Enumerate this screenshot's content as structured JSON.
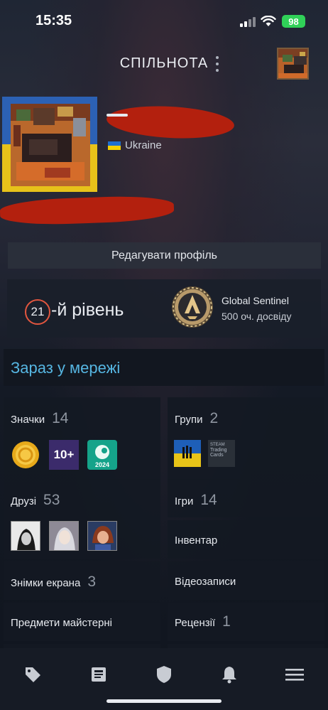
{
  "status_bar": {
    "time": "15:35",
    "battery": "98"
  },
  "header": {
    "title": "СПІЛЬНОТА",
    "menu_icon": "more-vertical-icon"
  },
  "profile": {
    "country": "Ukraine"
  },
  "edit_profile_label": "Редагувати профіль",
  "level": {
    "number": "21",
    "suffix": "-й рівень",
    "badge_name": "Global Sentinel",
    "badge_xp": "500 оч. досвіду"
  },
  "online_status": "Зараз у мережі",
  "tiles": {
    "badges": {
      "label": "Значки",
      "count": "14"
    },
    "groups": {
      "label": "Групи",
      "count": "2"
    },
    "friends": {
      "label": "Друзі",
      "count": "53"
    },
    "games": {
      "label": "Ігри",
      "count": "14"
    },
    "inventory": {
      "label": "Інвентар"
    },
    "screenshots": {
      "label": "Знімки екрана",
      "count": "3"
    },
    "videos": {
      "label": "Відеозаписи"
    },
    "workshop": {
      "label": "Предмети майстерні"
    },
    "reviews": {
      "label": "Рецензії",
      "count": "1"
    }
  },
  "icons": {
    "badge_10plus": "10+",
    "badge_2024": "2024",
    "group_trading_cards_line1": "STEAM",
    "group_trading_cards_line2": "Trading",
    "group_trading_cards_line3": "Cards"
  },
  "bottom_nav": [
    "tag-icon",
    "news-icon",
    "shield-icon",
    "bell-icon",
    "menu-icon"
  ],
  "colors": {
    "accent": "#56b6e2",
    "level_ring": "#e2563f",
    "battery": "#30d158",
    "redaction": "#b3200e"
  }
}
